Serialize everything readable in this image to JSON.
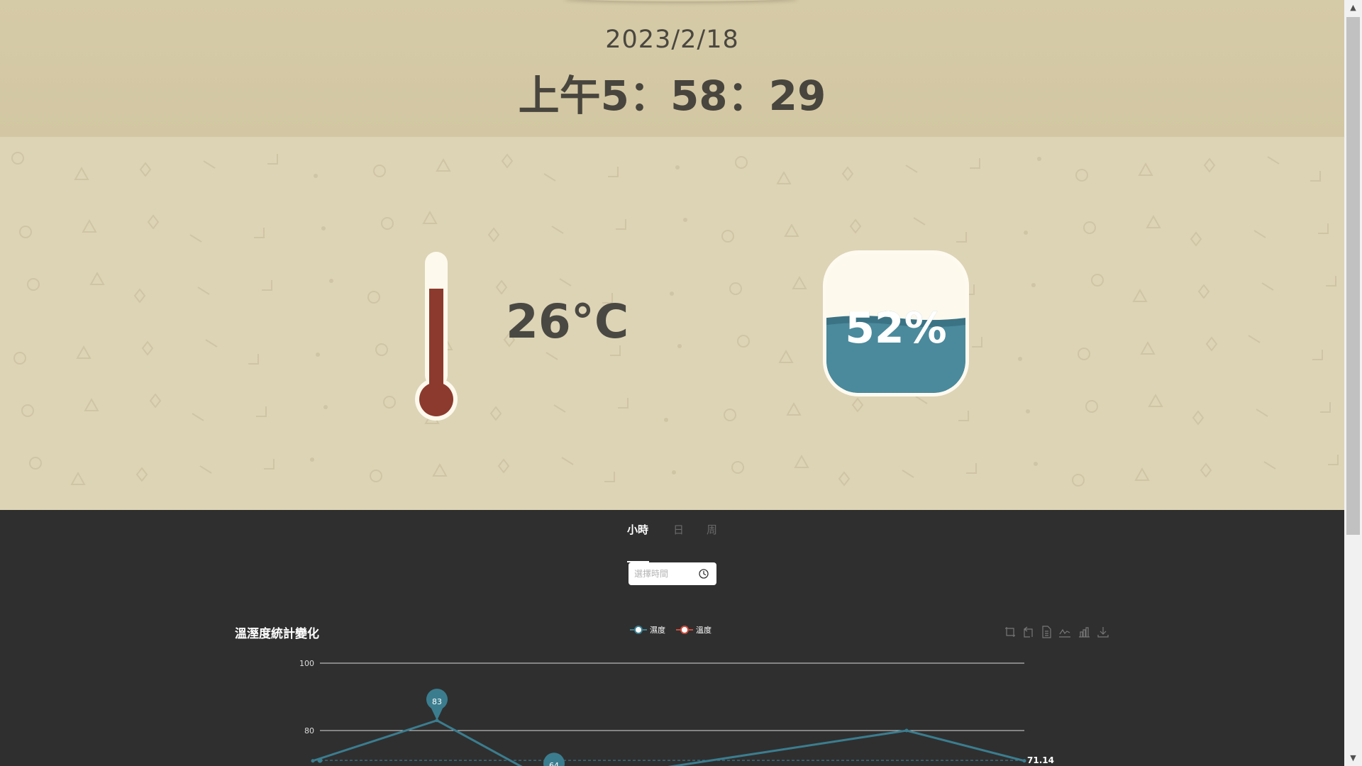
{
  "header": {
    "date": "2023/2/18",
    "time": "上午5：58：29"
  },
  "readings": {
    "temperature": {
      "value_label": "26°C",
      "level_fraction": 0.75,
      "color": "#8c3a2e"
    },
    "humidity": {
      "value_label": "52%",
      "level_fraction": 0.52,
      "color": "#4a8a9c"
    }
  },
  "panel": {
    "tabs": [
      {
        "label": "小時",
        "active": true
      },
      {
        "label": "日",
        "active": false
      },
      {
        "label": "周",
        "active": false
      }
    ],
    "time_picker": {
      "placeholder": "選擇時間",
      "icon": "clock-icon"
    },
    "toolbox": [
      {
        "icon": "zoom-icon",
        "name": "tool-zoom"
      },
      {
        "icon": "zoom-reset-icon",
        "name": "tool-zoom-reset"
      },
      {
        "icon": "data-view-icon",
        "name": "tool-data-view"
      },
      {
        "icon": "line-chart-icon",
        "name": "tool-line"
      },
      {
        "icon": "bar-chart-icon",
        "name": "tool-bar"
      },
      {
        "icon": "download-icon",
        "name": "tool-save-image"
      }
    ]
  },
  "chart_data": {
    "type": "line",
    "title": "溫溼度統計變化",
    "legend": [
      "濕度",
      "溫度"
    ],
    "legend_position": "top-center",
    "series": [
      {
        "name": "濕度",
        "color": "#3b7d8f",
        "values": [
          71,
          83,
          64,
          80,
          71
        ],
        "markers": [
          {
            "label": "83",
            "value": 83,
            "kind": "max-pin"
          },
          {
            "label": "64",
            "value": 64,
            "kind": "min-pin"
          }
        ],
        "average_line": {
          "label": "71.14",
          "value": 71.14
        }
      },
      {
        "name": "溫度",
        "color": "#c94a3c",
        "values": []
      }
    ],
    "yticks": [
      "100",
      "80"
    ],
    "ylim": [
      60,
      100
    ],
    "grid": true
  },
  "colors": {
    "header_bg": "#d4c9a4",
    "readings_bg": "#ddd4b6",
    "panel_bg": "#2f2f2f",
    "text_dark": "#4a4842"
  }
}
